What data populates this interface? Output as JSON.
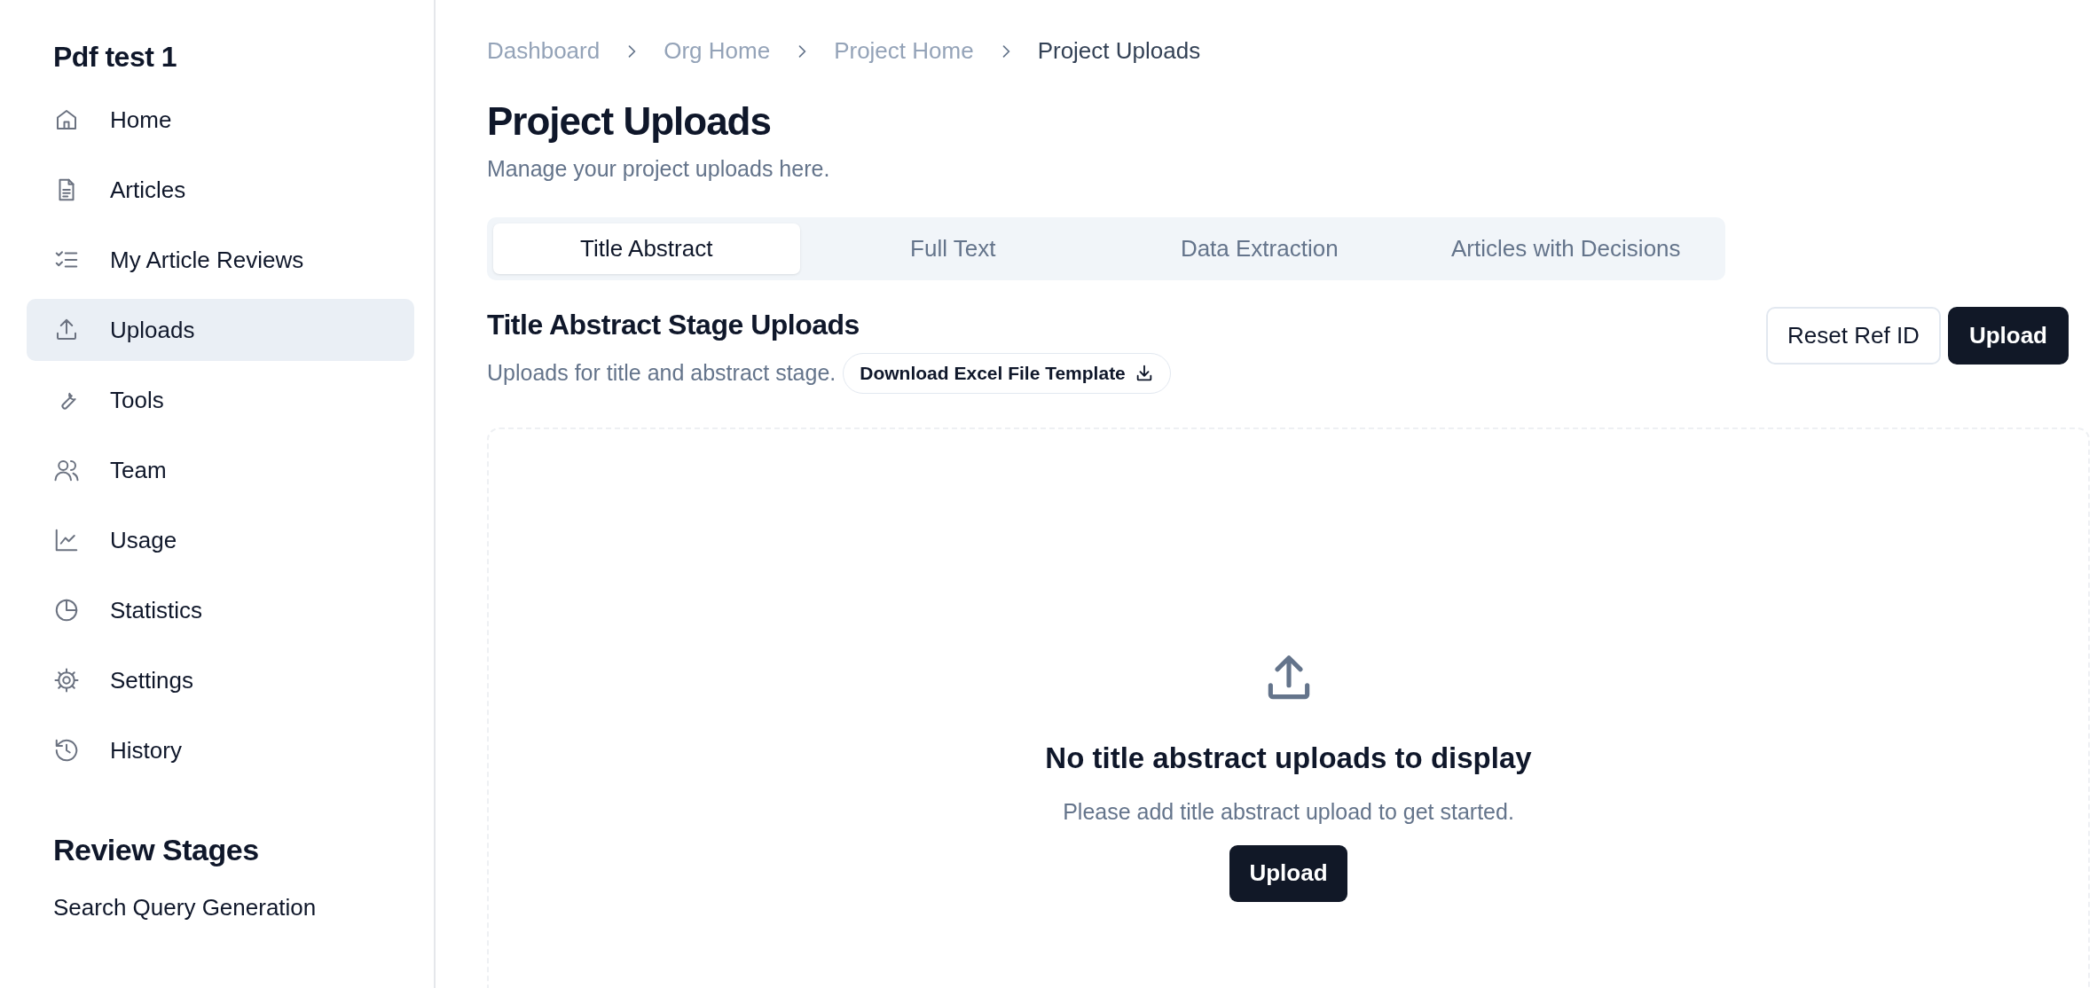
{
  "sidebar": {
    "title": "Pdf test 1",
    "items": [
      {
        "label": "Home",
        "selected": false
      },
      {
        "label": "Articles",
        "selected": false
      },
      {
        "label": "My Article Reviews",
        "selected": false
      },
      {
        "label": "Uploads",
        "selected": true
      },
      {
        "label": "Tools",
        "selected": false
      },
      {
        "label": "Team",
        "selected": false
      },
      {
        "label": "Usage",
        "selected": false
      },
      {
        "label": "Statistics",
        "selected": false
      },
      {
        "label": "Settings",
        "selected": false
      },
      {
        "label": "History",
        "selected": false
      }
    ],
    "section_title": "Review Stages",
    "stage_items": [
      "Search Query Generation"
    ]
  },
  "breadcrumb": [
    {
      "label": "Dashboard",
      "current": false
    },
    {
      "label": "Org Home",
      "current": false
    },
    {
      "label": "Project Home",
      "current": false
    },
    {
      "label": "Project Uploads",
      "current": true
    }
  ],
  "page": {
    "title": "Project Uploads",
    "subtitle": "Manage your project uploads here."
  },
  "tabs": [
    {
      "label": "Title Abstract",
      "selected": true
    },
    {
      "label": "Full Text",
      "selected": false
    },
    {
      "label": "Data Extraction",
      "selected": false
    },
    {
      "label": "Articles with Decisions",
      "selected": false
    }
  ],
  "section": {
    "title": "Title Abstract Stage Uploads",
    "subtitle": "Uploads for title and abstract stage.",
    "template_button": "Download Excel File Template",
    "buttons": [
      {
        "label": "Reset Ref ID",
        "kind": "outline"
      },
      {
        "label": "Upload",
        "kind": "primary"
      }
    ]
  },
  "empty_state": {
    "title": "No title abstract uploads to display",
    "text": "Please add title abstract upload to get started.",
    "button": "Upload"
  }
}
